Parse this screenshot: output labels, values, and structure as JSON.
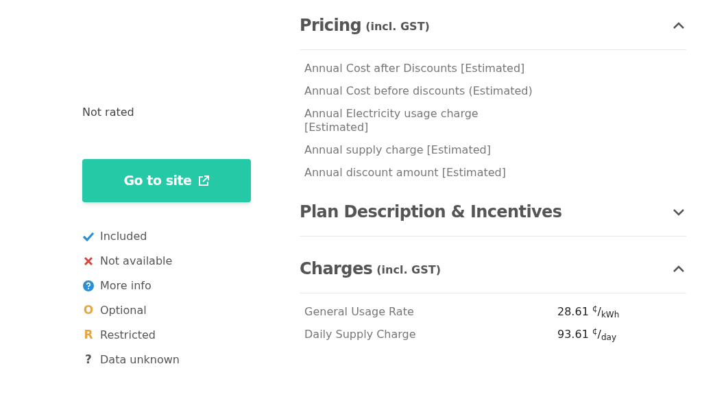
{
  "rating": "Not rated",
  "go_button": "Go to site",
  "legend": [
    {
      "kind": "check",
      "label": "Included"
    },
    {
      "kind": "cross",
      "label": "Not available"
    },
    {
      "kind": "info",
      "label": "More info"
    },
    {
      "kind": "letter",
      "symbol": "O",
      "color": "#e8a640",
      "label": "Optional"
    },
    {
      "kind": "letter",
      "symbol": "R",
      "color": "#e8a640",
      "label": "Restricted"
    },
    {
      "kind": "letter",
      "symbol": "?",
      "color": "#555555",
      "label": "Data unknown"
    }
  ],
  "sections": [
    {
      "title": "Pricing",
      "note": "(incl. GST)",
      "expanded": true,
      "rows": [
        {
          "label": "Annual Cost after Discounts [Estimated]"
        },
        {
          "label": "Annual Cost before discounts (Estimated)"
        },
        {
          "label": "Annual Electricity usage charge [Estimated]"
        },
        {
          "label": "Annual supply charge [Estimated]"
        },
        {
          "label": "Annual discount amount [Estimated]"
        }
      ]
    },
    {
      "title": "Plan Description & Incentives",
      "expanded": false
    },
    {
      "title": "Charges",
      "note": "(incl. GST)",
      "expanded": true,
      "rows": [
        {
          "label": "General Usage Rate",
          "value": "28.61 $^{¢}$/$_{kWh}$"
        },
        {
          "label": "Daily Supply Charge",
          "value": "93.61 $^{¢}$/$_{day}$"
        }
      ]
    }
  ]
}
